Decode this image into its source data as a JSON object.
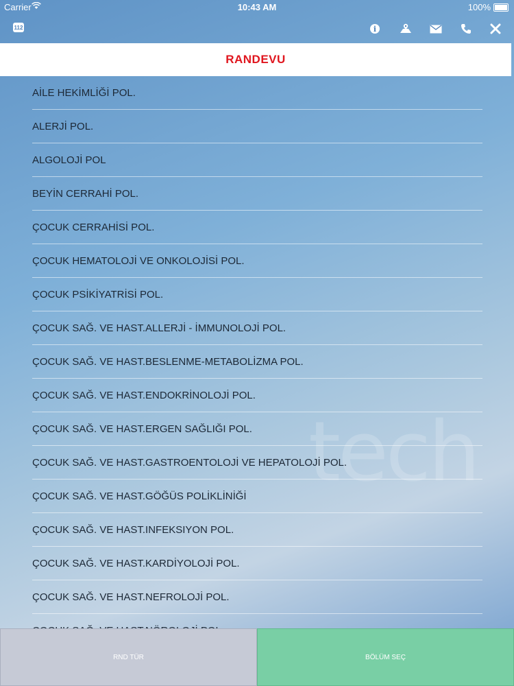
{
  "status_bar": {
    "carrier": "Carrier",
    "time": "10:43 AM",
    "battery": "100%"
  },
  "toolbar": {
    "emergency_label": "112",
    "icons": [
      "info-icon",
      "map-icon",
      "mail-icon",
      "phone-icon",
      "close-icon"
    ]
  },
  "header": {
    "title": "RANDEVU"
  },
  "watermark": "tech",
  "list": {
    "items": [
      "AİLE HEKİMLİĞİ POL.",
      "ALERJİ POL.",
      "ALGOLOJİ POL",
      "BEYİN CERRAHİ  POL.",
      "ÇOCUK CERRAHİSİ POL.",
      "ÇOCUK HEMATOLOJİ VE ONKOLOJİSİ  POL.",
      "ÇOCUK PSİKİYATRİSİ POL.",
      "ÇOCUK SAĞ. VE HAST.ALLERJİ - İMMUNOLOJİ POL.",
      "ÇOCUK SAĞ. VE HAST.BESLENME-METABOLİZMA POL.",
      "ÇOCUK SAĞ. VE HAST.ENDOKRİNOLOJİ POL.",
      "ÇOCUK SAĞ. VE HAST.ERGEN SAĞLIĞI POL.",
      "ÇOCUK SAĞ. VE HAST.GASTROENTOLOJİ VE HEPATOLOJİ POL.",
      "ÇOCUK SAĞ. VE HAST.GÖĞÜS POLİKLİNİĞİ",
      "ÇOCUK SAĞ. VE HAST.INFEKSIYON POL.",
      "ÇOCUK SAĞ. VE HAST.KARDİYOLOJİ POL.",
      "ÇOCUK SAĞ. VE HAST.NEFROLOJİ POL.",
      "ÇOCUK SAĞ. VE HAST.NÖROLOJİ POL."
    ]
  },
  "bottom": {
    "left_label": "RND TÜR",
    "right_label": "BÖLÜM SEÇ"
  },
  "colors": {
    "title": "#e0161e",
    "left_button": "#c6cad6",
    "right_button": "#79cfa5"
  }
}
